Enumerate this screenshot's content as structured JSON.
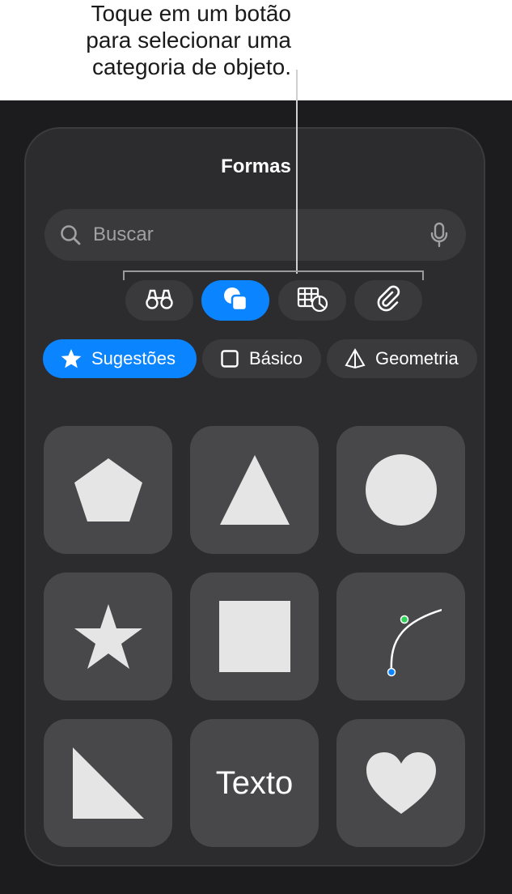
{
  "callout": {
    "line1": "Toque em um botão",
    "line2": "para selecionar uma",
    "line3": "categoria de objeto."
  },
  "panel": {
    "title": "Formas"
  },
  "search": {
    "placeholder": "Buscar"
  },
  "object_tabs": [
    {
      "icon": "binoculars-icon",
      "selected": false
    },
    {
      "icon": "shapes-icon",
      "selected": true
    },
    {
      "icon": "table-chart-icon",
      "selected": false
    },
    {
      "icon": "paperclip-icon",
      "selected": false
    }
  ],
  "categories": [
    {
      "label": "Sugestões",
      "icon": "star-icon",
      "selected": true
    },
    {
      "label": "Básico",
      "icon": "square-outline-icon",
      "selected": false
    },
    {
      "label": "Geometria",
      "icon": "pyramid-icon",
      "selected": false
    }
  ],
  "shapes": {
    "text_shape_label": "Texto",
    "items": [
      "pentagon-shape",
      "triangle-shape",
      "circle-shape",
      "star-shape",
      "square-shape",
      "curve-shape",
      "right-triangle-shape",
      "text-shape",
      "heart-shape"
    ]
  },
  "colors": {
    "accent": "#0a84ff",
    "panel": "#2c2c2e",
    "tile": "#48484a",
    "shape_fill": "#e5e5e5",
    "curve_green": "#30d158"
  }
}
